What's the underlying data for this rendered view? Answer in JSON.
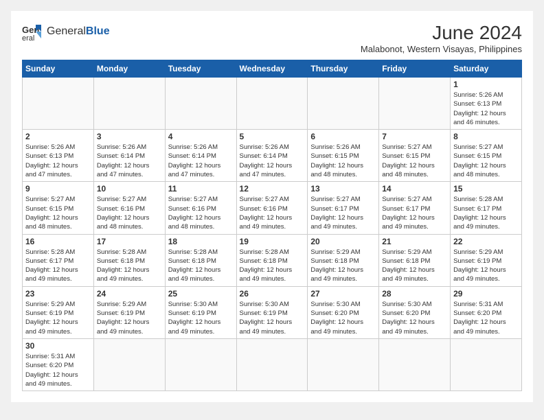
{
  "logo": {
    "general": "General",
    "blue": "Blue"
  },
  "title": "June 2024",
  "location": "Malabonot, Western Visayas, Philippines",
  "days_of_week": [
    "Sunday",
    "Monday",
    "Tuesday",
    "Wednesday",
    "Thursday",
    "Friday",
    "Saturday"
  ],
  "weeks": [
    [
      {
        "day": "",
        "info": ""
      },
      {
        "day": "",
        "info": ""
      },
      {
        "day": "",
        "info": ""
      },
      {
        "day": "",
        "info": ""
      },
      {
        "day": "",
        "info": ""
      },
      {
        "day": "",
        "info": ""
      },
      {
        "day": "1",
        "info": "Sunrise: 5:26 AM\nSunset: 6:13 PM\nDaylight: 12 hours and 46 minutes."
      }
    ],
    [
      {
        "day": "2",
        "info": "Sunrise: 5:26 AM\nSunset: 6:13 PM\nDaylight: 12 hours and 47 minutes."
      },
      {
        "day": "3",
        "info": "Sunrise: 5:26 AM\nSunset: 6:14 PM\nDaylight: 12 hours and 47 minutes."
      },
      {
        "day": "4",
        "info": "Sunrise: 5:26 AM\nSunset: 6:14 PM\nDaylight: 12 hours and 47 minutes."
      },
      {
        "day": "5",
        "info": "Sunrise: 5:26 AM\nSunset: 6:14 PM\nDaylight: 12 hours and 47 minutes."
      },
      {
        "day": "6",
        "info": "Sunrise: 5:26 AM\nSunset: 6:15 PM\nDaylight: 12 hours and 48 minutes."
      },
      {
        "day": "7",
        "info": "Sunrise: 5:27 AM\nSunset: 6:15 PM\nDaylight: 12 hours and 48 minutes."
      },
      {
        "day": "8",
        "info": "Sunrise: 5:27 AM\nSunset: 6:15 PM\nDaylight: 12 hours and 48 minutes."
      }
    ],
    [
      {
        "day": "9",
        "info": "Sunrise: 5:27 AM\nSunset: 6:15 PM\nDaylight: 12 hours and 48 minutes."
      },
      {
        "day": "10",
        "info": "Sunrise: 5:27 AM\nSunset: 6:16 PM\nDaylight: 12 hours and 48 minutes."
      },
      {
        "day": "11",
        "info": "Sunrise: 5:27 AM\nSunset: 6:16 PM\nDaylight: 12 hours and 48 minutes."
      },
      {
        "day": "12",
        "info": "Sunrise: 5:27 AM\nSunset: 6:16 PM\nDaylight: 12 hours and 49 minutes."
      },
      {
        "day": "13",
        "info": "Sunrise: 5:27 AM\nSunset: 6:17 PM\nDaylight: 12 hours and 49 minutes."
      },
      {
        "day": "14",
        "info": "Sunrise: 5:27 AM\nSunset: 6:17 PM\nDaylight: 12 hours and 49 minutes."
      },
      {
        "day": "15",
        "info": "Sunrise: 5:28 AM\nSunset: 6:17 PM\nDaylight: 12 hours and 49 minutes."
      }
    ],
    [
      {
        "day": "16",
        "info": "Sunrise: 5:28 AM\nSunset: 6:17 PM\nDaylight: 12 hours and 49 minutes."
      },
      {
        "day": "17",
        "info": "Sunrise: 5:28 AM\nSunset: 6:18 PM\nDaylight: 12 hours and 49 minutes."
      },
      {
        "day": "18",
        "info": "Sunrise: 5:28 AM\nSunset: 6:18 PM\nDaylight: 12 hours and 49 minutes."
      },
      {
        "day": "19",
        "info": "Sunrise: 5:28 AM\nSunset: 6:18 PM\nDaylight: 12 hours and 49 minutes."
      },
      {
        "day": "20",
        "info": "Sunrise: 5:29 AM\nSunset: 6:18 PM\nDaylight: 12 hours and 49 minutes."
      },
      {
        "day": "21",
        "info": "Sunrise: 5:29 AM\nSunset: 6:18 PM\nDaylight: 12 hours and 49 minutes."
      },
      {
        "day": "22",
        "info": "Sunrise: 5:29 AM\nSunset: 6:19 PM\nDaylight: 12 hours and 49 minutes."
      }
    ],
    [
      {
        "day": "23",
        "info": "Sunrise: 5:29 AM\nSunset: 6:19 PM\nDaylight: 12 hours and 49 minutes."
      },
      {
        "day": "24",
        "info": "Sunrise: 5:29 AM\nSunset: 6:19 PM\nDaylight: 12 hours and 49 minutes."
      },
      {
        "day": "25",
        "info": "Sunrise: 5:30 AM\nSunset: 6:19 PM\nDaylight: 12 hours and 49 minutes."
      },
      {
        "day": "26",
        "info": "Sunrise: 5:30 AM\nSunset: 6:19 PM\nDaylight: 12 hours and 49 minutes."
      },
      {
        "day": "27",
        "info": "Sunrise: 5:30 AM\nSunset: 6:20 PM\nDaylight: 12 hours and 49 minutes."
      },
      {
        "day": "28",
        "info": "Sunrise: 5:30 AM\nSunset: 6:20 PM\nDaylight: 12 hours and 49 minutes."
      },
      {
        "day": "29",
        "info": "Sunrise: 5:31 AM\nSunset: 6:20 PM\nDaylight: 12 hours and 49 minutes."
      }
    ],
    [
      {
        "day": "30",
        "info": "Sunrise: 5:31 AM\nSunset: 6:20 PM\nDaylight: 12 hours and 49 minutes."
      },
      {
        "day": "",
        "info": ""
      },
      {
        "day": "",
        "info": ""
      },
      {
        "day": "",
        "info": ""
      },
      {
        "day": "",
        "info": ""
      },
      {
        "day": "",
        "info": ""
      },
      {
        "day": "",
        "info": ""
      }
    ]
  ]
}
